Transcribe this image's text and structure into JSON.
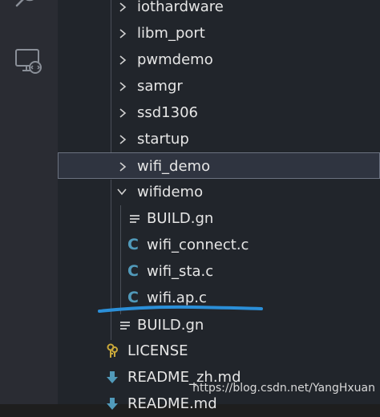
{
  "activity_bar": {
    "icons": [
      "search-icon",
      "remote-explorer-icon"
    ]
  },
  "explorer": {
    "items": [
      {
        "label": "iothardware",
        "type": "folder",
        "state": "collapsed"
      },
      {
        "label": "libm_port",
        "type": "folder",
        "state": "collapsed"
      },
      {
        "label": "pwmdemo",
        "type": "folder",
        "state": "collapsed"
      },
      {
        "label": "samgr",
        "type": "folder",
        "state": "collapsed"
      },
      {
        "label": "ssd1306",
        "type": "folder",
        "state": "collapsed"
      },
      {
        "label": "startup",
        "type": "folder",
        "state": "collapsed"
      },
      {
        "label": "wifi_demo",
        "type": "folder",
        "state": "collapsed",
        "selected": true
      },
      {
        "label": "wifidemo",
        "type": "folder",
        "state": "expanded"
      },
      {
        "label": "BUILD.gn",
        "type": "file",
        "icon": "lines-icon"
      },
      {
        "label": "wifi_connect.c",
        "type": "file",
        "icon": "c-file-icon",
        "icon_text": "C"
      },
      {
        "label": "wifi_sta.c",
        "type": "file",
        "icon": "c-file-icon",
        "icon_text": "C"
      },
      {
        "label": "wifi.ap.c",
        "type": "file",
        "icon": "c-file-icon",
        "icon_text": "C"
      },
      {
        "label": "BUILD.gn",
        "type": "file",
        "icon": "lines-icon"
      },
      {
        "label": "LICENSE",
        "type": "file",
        "icon": "license-icon"
      },
      {
        "label": "README_zh.md",
        "type": "file",
        "icon": "markdown-icon"
      },
      {
        "label": "README.md",
        "type": "file",
        "icon": "markdown-icon"
      }
    ]
  },
  "colors": {
    "underline": "#2b8fd8",
    "c_icon": "#519aba",
    "license_icon": "#c9a83a",
    "markdown_icon": "#519aba"
  },
  "watermark": "https://blog.csdn.net/YangHxuan"
}
